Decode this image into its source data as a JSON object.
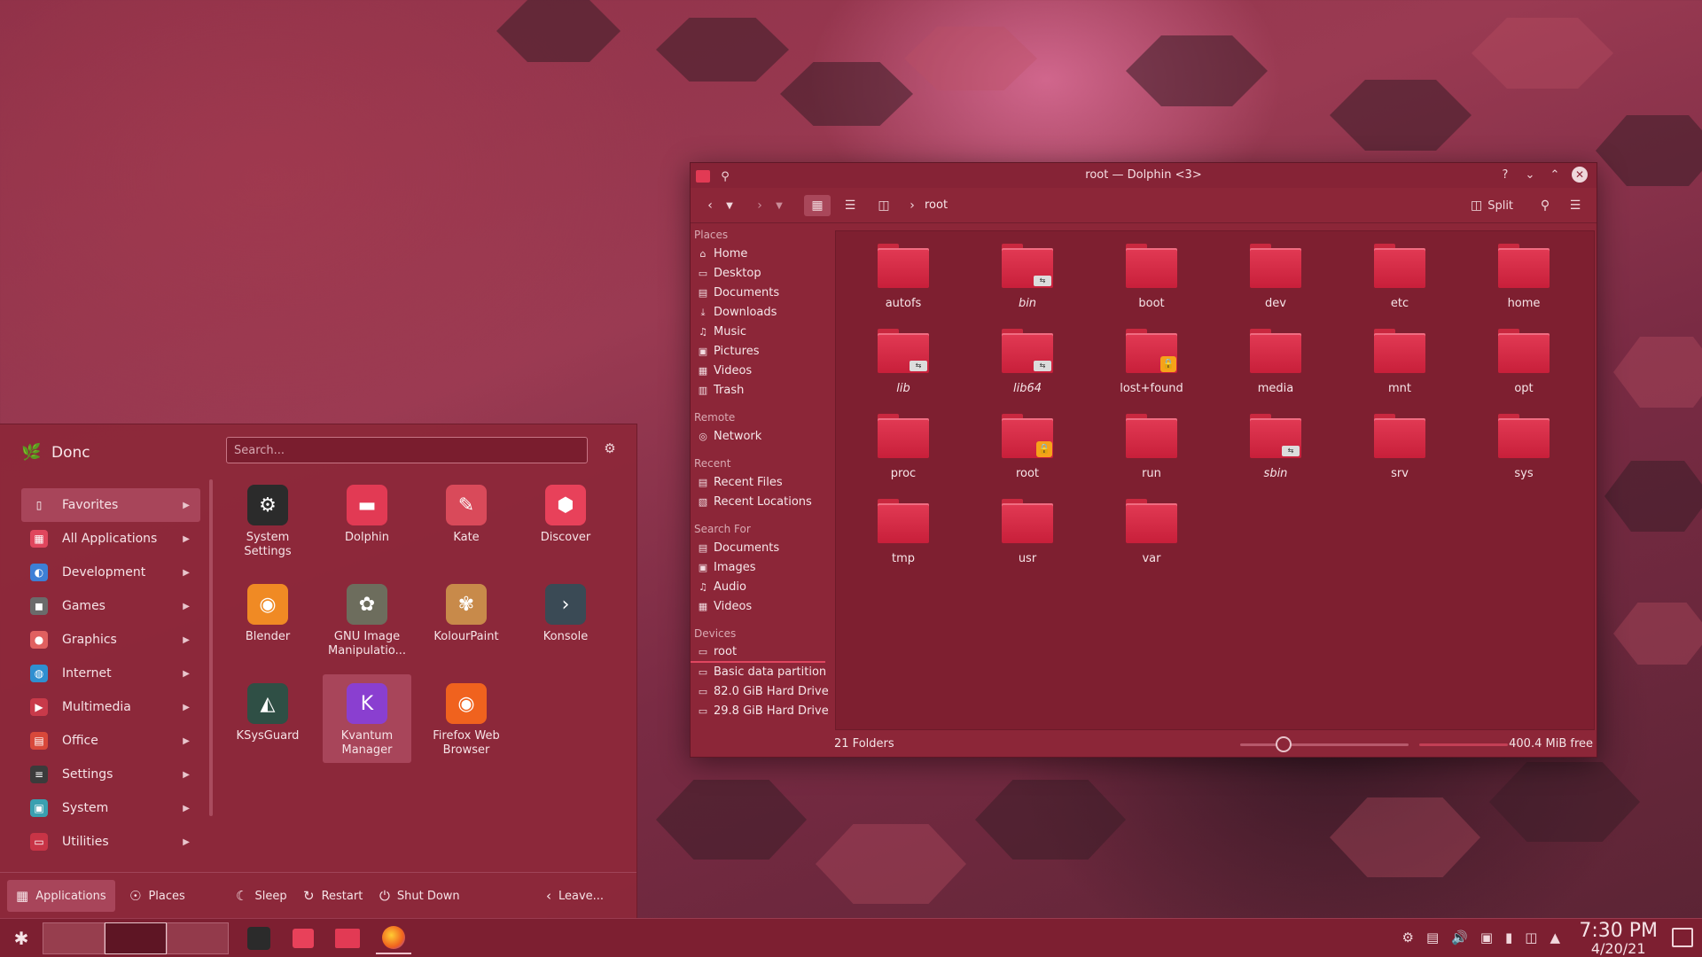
{
  "dolphin": {
    "title": "root — Dolphin <3>",
    "breadcrumb": "root",
    "split_label": "Split",
    "sidebar": [
      {
        "heading": "Places",
        "items": [
          {
            "label": "Home",
            "icon": "home-icon"
          },
          {
            "label": "Desktop",
            "icon": "desktop-icon"
          },
          {
            "label": "Documents",
            "icon": "documents-icon"
          },
          {
            "label": "Downloads",
            "icon": "downloads-icon"
          },
          {
            "label": "Music",
            "icon": "music-icon"
          },
          {
            "label": "Pictures",
            "icon": "pictures-icon"
          },
          {
            "label": "Videos",
            "icon": "videos-icon"
          },
          {
            "label": "Trash",
            "icon": "trash-icon"
          }
        ]
      },
      {
        "heading": "Remote",
        "items": [
          {
            "label": "Network",
            "icon": "network-icon"
          }
        ]
      },
      {
        "heading": "Recent",
        "items": [
          {
            "label": "Recent Files",
            "icon": "recent-files-icon"
          },
          {
            "label": "Recent Locations",
            "icon": "recent-locations-icon"
          }
        ]
      },
      {
        "heading": "Search For",
        "items": [
          {
            "label": "Documents",
            "icon": "documents-icon"
          },
          {
            "label": "Images",
            "icon": "images-icon"
          },
          {
            "label": "Audio",
            "icon": "audio-icon"
          },
          {
            "label": "Videos",
            "icon": "videos-icon"
          }
        ]
      },
      {
        "heading": "Devices",
        "items": [
          {
            "label": "root",
            "icon": "drive-icon"
          },
          {
            "label": "Basic data partition",
            "icon": "drive-icon"
          },
          {
            "label": "82.0 GiB Hard Drive",
            "icon": "drive-icon"
          },
          {
            "label": "29.8 GiB Hard Drive",
            "icon": "drive-icon"
          }
        ]
      }
    ],
    "folders": [
      {
        "name": "autofs",
        "italic": false,
        "badge": ""
      },
      {
        "name": "bin",
        "italic": true,
        "badge": "link"
      },
      {
        "name": "boot",
        "italic": false,
        "badge": ""
      },
      {
        "name": "dev",
        "italic": false,
        "badge": ""
      },
      {
        "name": "etc",
        "italic": false,
        "badge": ""
      },
      {
        "name": "home",
        "italic": false,
        "badge": ""
      },
      {
        "name": "lib",
        "italic": true,
        "badge": "link"
      },
      {
        "name": "lib64",
        "italic": true,
        "badge": "link"
      },
      {
        "name": "lost+found",
        "italic": false,
        "badge": "lock"
      },
      {
        "name": "media",
        "italic": false,
        "badge": ""
      },
      {
        "name": "mnt",
        "italic": false,
        "badge": ""
      },
      {
        "name": "opt",
        "italic": false,
        "badge": ""
      },
      {
        "name": "proc",
        "italic": false,
        "badge": ""
      },
      {
        "name": "root",
        "italic": false,
        "badge": "lock"
      },
      {
        "name": "run",
        "italic": false,
        "badge": ""
      },
      {
        "name": "sbin",
        "italic": true,
        "badge": "link"
      },
      {
        "name": "srv",
        "italic": false,
        "badge": ""
      },
      {
        "name": "sys",
        "italic": false,
        "badge": ""
      },
      {
        "name": "tmp",
        "italic": false,
        "badge": ""
      },
      {
        "name": "usr",
        "italic": false,
        "badge": ""
      },
      {
        "name": "var",
        "italic": false,
        "badge": ""
      }
    ],
    "status": {
      "count": "21 Folders",
      "free": "400.4 MiB free"
    }
  },
  "launcher": {
    "user": "Donc",
    "search_placeholder": "Search...",
    "categories": [
      {
        "label": "Favorites",
        "icon": "bookmark-icon",
        "color": "transparent"
      },
      {
        "label": "All Applications",
        "icon": "grid-icon",
        "color": "#e0465d"
      },
      {
        "label": "Development",
        "icon": "development-icon",
        "color": "#3d7fd6"
      },
      {
        "label": "Games",
        "icon": "gamepad-icon",
        "color": "#6b6b6b"
      },
      {
        "label": "Graphics",
        "icon": "graphics-icon",
        "color": "#e06060"
      },
      {
        "label": "Internet",
        "icon": "globe-icon",
        "color": "#2f8fd0"
      },
      {
        "label": "Multimedia",
        "icon": "multimedia-icon",
        "color": "#c83a4a"
      },
      {
        "label": "Office",
        "icon": "office-icon",
        "color": "#d8483a"
      },
      {
        "label": "Settings",
        "icon": "settings-icon",
        "color": "#3b3b3b"
      },
      {
        "label": "System",
        "icon": "system-icon",
        "color": "#3aa0b0"
      },
      {
        "label": "Utilities",
        "icon": "utilities-icon",
        "color": "#c83446"
      }
    ],
    "apps": [
      {
        "label": "System Settings",
        "icon": "system-settings-icon",
        "color": "#2b2b2b"
      },
      {
        "label": "Dolphin",
        "icon": "dolphin-icon",
        "color": "#e23a54"
      },
      {
        "label": "Kate",
        "icon": "kate-icon",
        "color": "#d94a5a"
      },
      {
        "label": "Discover",
        "icon": "discover-icon",
        "color": "#e8415a"
      },
      {
        "label": "Blender",
        "icon": "blender-icon",
        "color": "#f08a24"
      },
      {
        "label": "GNU Image Manipulatio...",
        "icon": "gimp-icon",
        "color": "#6d6d5d"
      },
      {
        "label": "KolourPaint",
        "icon": "kolourpaint-icon",
        "color": "#c88a4a"
      },
      {
        "label": "Konsole",
        "icon": "konsole-icon",
        "color": "#3a4a55"
      },
      {
        "label": "KSysGuard",
        "icon": "ksysguard-icon",
        "color": "#2f4f45"
      },
      {
        "label": "Kvantum Manager",
        "icon": "kvantum-icon",
        "color": "#8a3fd0"
      },
      {
        "label": "Firefox Web Browser",
        "icon": "firefox-icon",
        "color": "#f0621e"
      }
    ],
    "bottom": {
      "applications": "Applications",
      "places": "Places",
      "sleep": "Sleep",
      "restart": "Restart",
      "shutdown": "Shut Down",
      "leave": "Leave..."
    }
  },
  "taskbar": {
    "time": "7:30 PM",
    "date": "4/20/21"
  }
}
